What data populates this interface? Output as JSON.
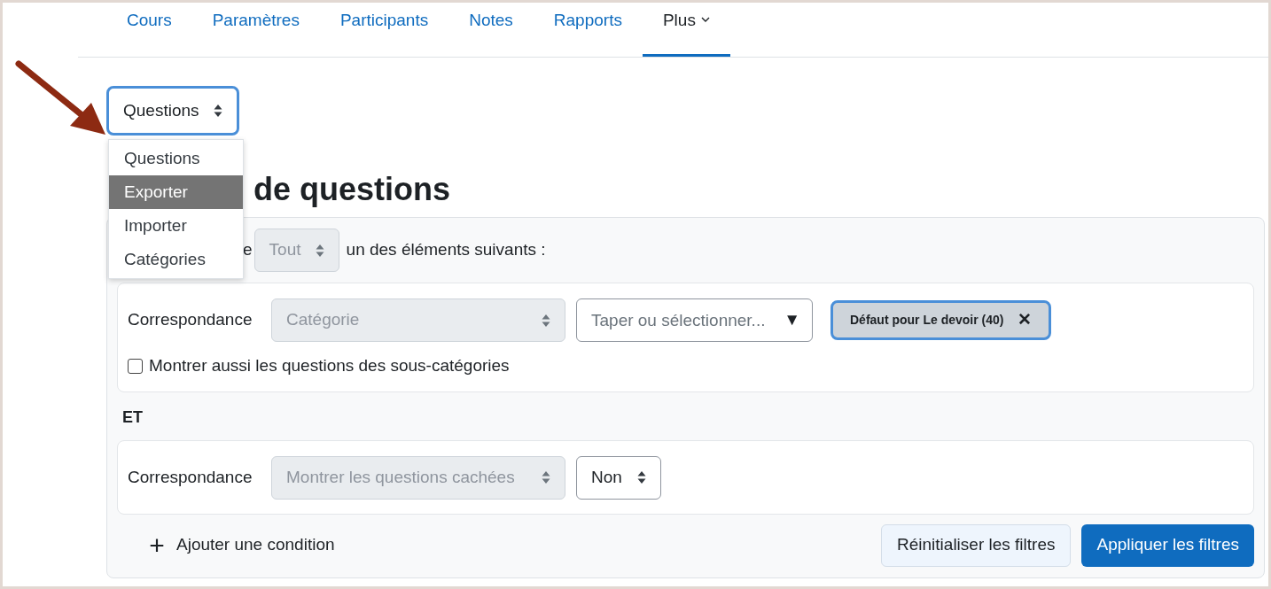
{
  "nav_tabs": [
    {
      "label": "Cours",
      "selected": false
    },
    {
      "label": "Paramètres",
      "selected": false
    },
    {
      "label": "Participants",
      "selected": false
    },
    {
      "label": "Notes",
      "selected": false
    },
    {
      "label": "Rapports",
      "selected": false
    },
    {
      "label": "Plus",
      "selected": true,
      "has_menu": true
    }
  ],
  "page_select": {
    "value": "Questions",
    "focused": true
  },
  "page_menu": [
    {
      "label": "Questions",
      "selected": false
    },
    {
      "label": "Exporter",
      "selected": true
    },
    {
      "label": "Importer",
      "selected": false
    },
    {
      "label": "Catégories",
      "selected": false
    }
  ],
  "heading": "de questions",
  "filters": {
    "match_prefix": "e",
    "match_select": {
      "value": "Tout",
      "disabled": true
    },
    "match_suffix": "un des éléments suivants :",
    "conditions": [
      {
        "label": "Correspondance",
        "type_select": {
          "value": "Catégorie",
          "disabled": true
        },
        "autocomplete": {
          "placeholder": "Taper ou sélectionner...",
          "arrow": "▼"
        },
        "chip": {
          "label": "Défaut pour Le devoir (40)",
          "close": "✕"
        },
        "checkbox": {
          "label": "Montrer aussi les questions des sous-catégories",
          "checked": false
        }
      },
      {
        "label": "Correspondance",
        "type_select": {
          "value": "Montrer les questions cachées",
          "disabled": true
        },
        "value_select": {
          "value": "Non",
          "disabled": false
        }
      }
    ],
    "joiner": "ET",
    "add_condition": {
      "icon": "+",
      "label": "Ajouter une condition"
    },
    "buttons": [
      {
        "label": "Réinitialiser les filtres",
        "kind": "secondary"
      },
      {
        "label": "Appliquer les filtres",
        "kind": "primary"
      }
    ]
  }
}
